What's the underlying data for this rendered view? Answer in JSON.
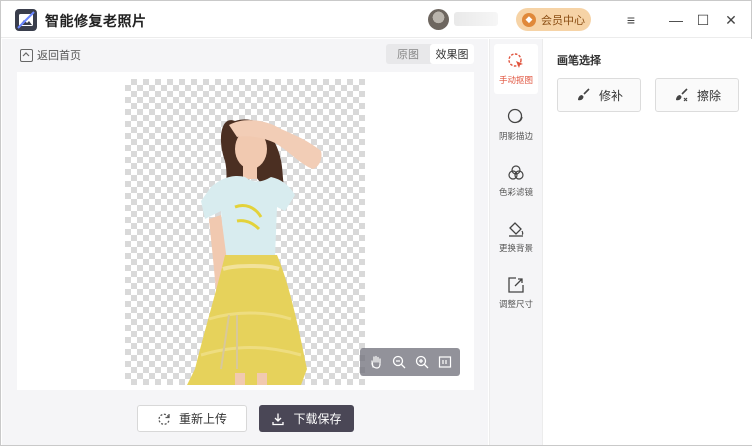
{
  "app": {
    "title": "智能修复老照片"
  },
  "header": {
    "vip_label": "会员中心",
    "min_glyph": "—",
    "max_glyph": "☐",
    "close_glyph": "✕",
    "menu_glyph": "≡"
  },
  "nav": {
    "back_label": "返回首页"
  },
  "view_toggle": {
    "original": "原图",
    "result": "效果图",
    "active": "result"
  },
  "actions": {
    "reupload_label": "重新上传",
    "download_label": "下载保存"
  },
  "tools": [
    {
      "label": "手动抠图",
      "icon": "cursor-brush-icon",
      "active": true
    },
    {
      "label": "阴影描边",
      "icon": "shadow-stroke-icon",
      "active": false
    },
    {
      "label": "色彩滤镜",
      "icon": "color-filter-icon",
      "active": false
    },
    {
      "label": "更换背景",
      "icon": "paint-bucket-icon",
      "active": false
    },
    {
      "label": "调整尺寸",
      "icon": "resize-icon",
      "active": false
    }
  ],
  "options": {
    "title": "画笔选择",
    "repair_label": "修补",
    "erase_label": "擦除"
  },
  "colors": {
    "accent": "#e0533d",
    "vip_bg": "#f6d3a6",
    "download_bg": "#4a4756"
  }
}
